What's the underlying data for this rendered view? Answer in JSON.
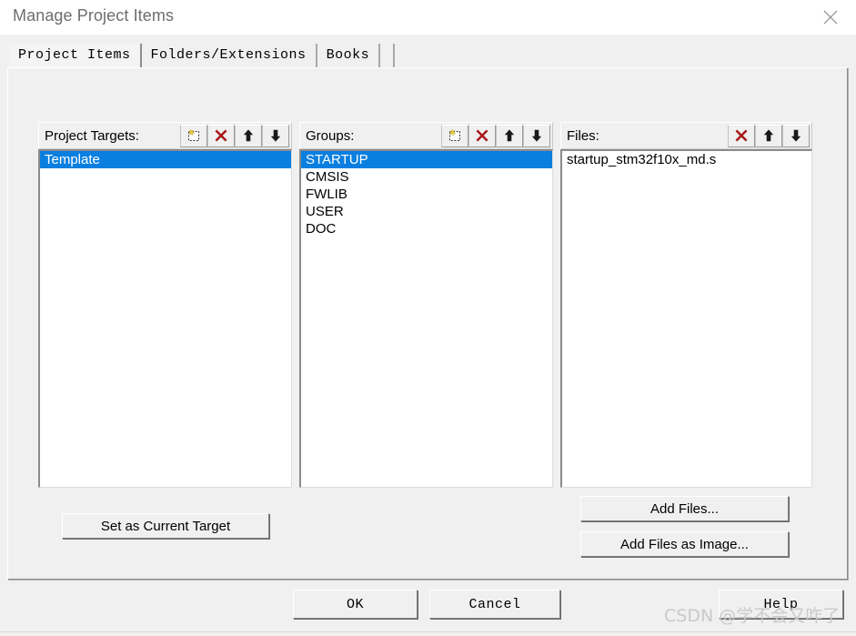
{
  "window": {
    "title": "Manage Project Items",
    "close_icon": "close-icon"
  },
  "tabs": [
    {
      "label": "Project Items",
      "active": true
    },
    {
      "label": "Folders/Extensions",
      "active": false
    },
    {
      "label": "Books",
      "active": false
    }
  ],
  "columns": {
    "project_targets": {
      "header": "Project Targets:",
      "icons": [
        "new-item-icon",
        "delete-icon",
        "move-up-icon",
        "move-down-icon"
      ],
      "items": [
        {
          "label": "Template",
          "selected": true
        }
      ]
    },
    "groups": {
      "header": "Groups:",
      "icons": [
        "new-item-icon",
        "delete-icon",
        "move-up-icon",
        "move-down-icon"
      ],
      "items": [
        {
          "label": "STARTUP",
          "selected": true
        },
        {
          "label": "CMSIS",
          "selected": false
        },
        {
          "label": "FWLIB",
          "selected": false
        },
        {
          "label": "USER",
          "selected": false
        },
        {
          "label": "DOC",
          "selected": false
        }
      ]
    },
    "files": {
      "header": "Files:",
      "icons": [
        "delete-icon",
        "move-up-icon",
        "move-down-icon"
      ],
      "items": [
        {
          "label": "startup_stm32f10x_md.s",
          "selected": false
        }
      ]
    }
  },
  "buttons": {
    "set_as_current_target": "Set as Current Target",
    "add_files": "Add Files...",
    "add_files_as_image": "Add Files as Image...",
    "ok": "OK",
    "cancel": "Cancel",
    "help": "Help"
  },
  "watermark": {
    "text": "CSDN @学不会又咋了"
  },
  "colors": {
    "selection_blue": "#0a7fe0",
    "dialog_face": "#f0f0f0",
    "delete_red": "#a81818",
    "title_gray": "#6e6e6e"
  }
}
